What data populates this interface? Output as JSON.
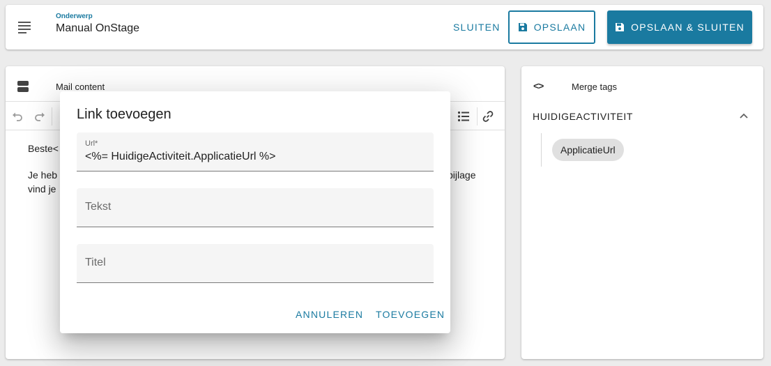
{
  "header": {
    "subject_label": "Onderwerp",
    "subject_value": "Manual OnStage",
    "close_label": "SLUITEN",
    "save_label": "OPSLAAN",
    "save_close_label": "OPSLAAN & SLUITEN"
  },
  "mail": {
    "title": "Mail content",
    "line1": "Beste<",
    "line2_start": "Je heb",
    "line2_end": "bijlage",
    "line3_start": "vind je"
  },
  "merge": {
    "title": "Merge tags",
    "section": "HUIDIGEACTIVITEIT",
    "chip": "ApplicatieUrl"
  },
  "dialog": {
    "title": "Link toevoegen",
    "url_label": "Url*",
    "url_value": "<%= HuidigeActiviteit.ApplicatieUrl %>",
    "text_placeholder": "Tekst",
    "title_placeholder": "Titel",
    "cancel_label": "ANNULEREN",
    "add_label": "TOEVOEGEN"
  },
  "colors": {
    "accent": "#1a7aa0"
  }
}
